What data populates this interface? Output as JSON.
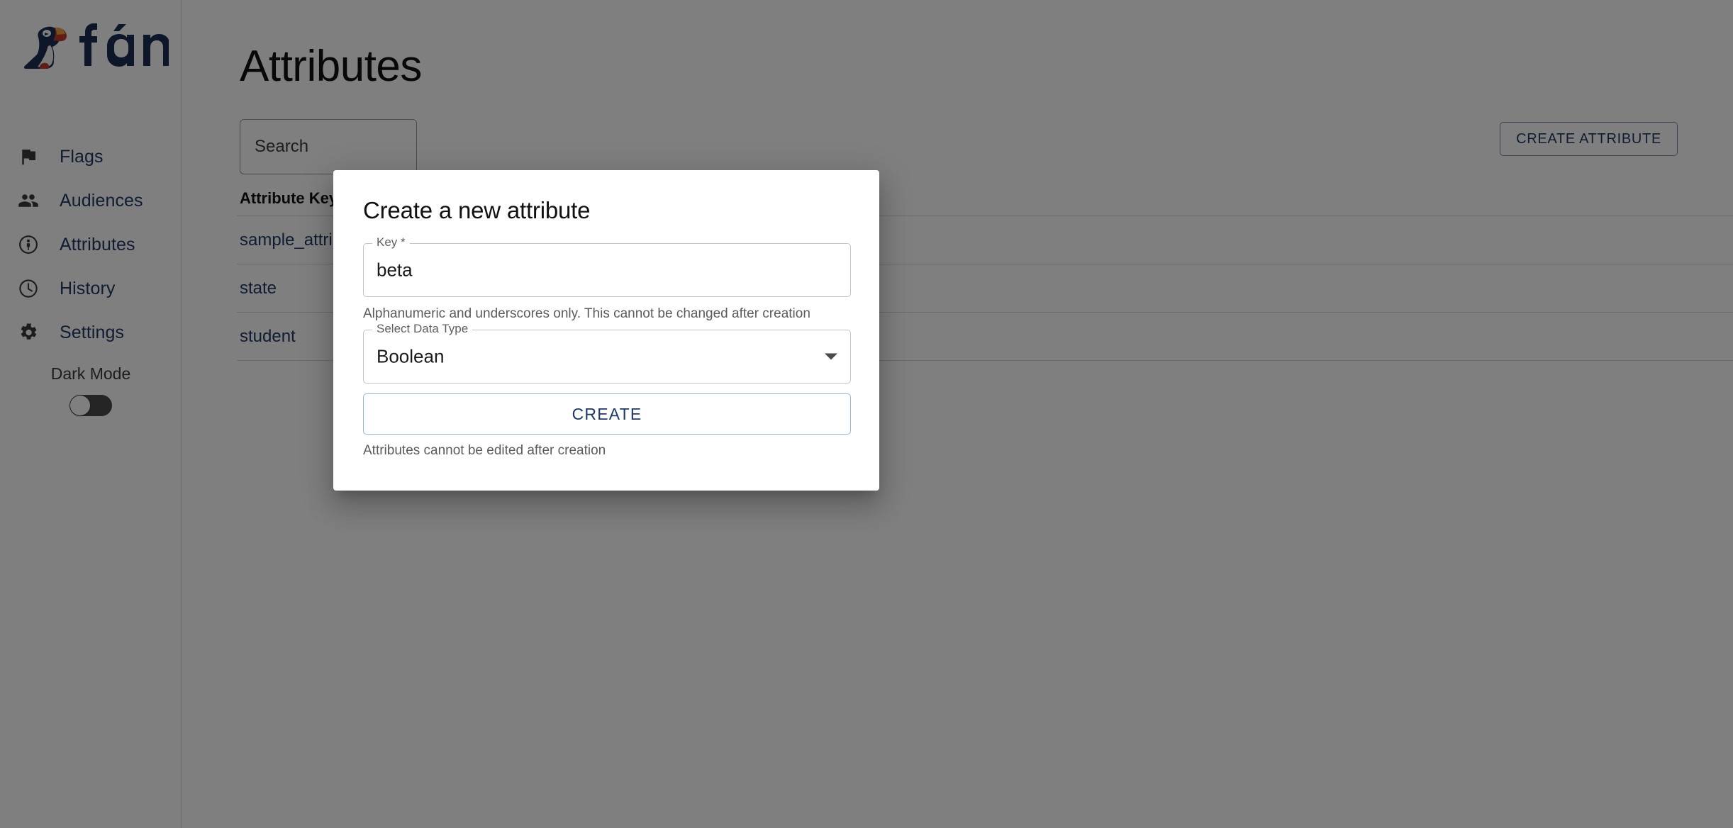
{
  "app": {
    "brand_name": "fána",
    "logo_icon": "puffin-logo",
    "colors": {
      "brand_navy": "#1f3864",
      "brand_red": "#b23a34",
      "brand_orange": "#e8a33d",
      "link_blue": "#1f3864",
      "scrim": "rgba(0,0,0,0.5)"
    }
  },
  "sidebar": {
    "items": [
      {
        "label": "Flags",
        "icon": "flag-icon"
      },
      {
        "label": "Audiences",
        "icon": "people-group-icon"
      },
      {
        "label": "Attributes",
        "icon": "account-info-circle-icon"
      },
      {
        "label": "History",
        "icon": "clock-icon"
      },
      {
        "label": "Settings",
        "icon": "gear-icon"
      }
    ],
    "dark_mode": {
      "label": "Dark Mode",
      "enabled": false
    }
  },
  "main": {
    "title": "Attributes",
    "search": {
      "placeholder": "Search",
      "value": ""
    },
    "create_attribute_button": "CREATE ATTRIBUTE",
    "table": {
      "columns": [
        "Attribute Key"
      ],
      "rows": [
        {
          "attribute_key": "sample_attribute"
        },
        {
          "attribute_key": "state"
        },
        {
          "attribute_key": "student"
        }
      ]
    }
  },
  "dialog": {
    "title": "Create a new attribute",
    "key_field": {
      "label": "Key *",
      "value": "beta",
      "helper_text": "Alphanumeric and underscores only. This cannot be changed after creation"
    },
    "data_type_field": {
      "label": "Select Data Type",
      "value": "Boolean",
      "caret_icon": "chevron-down-icon"
    },
    "submit_button": "CREATE",
    "footer_note": "Attributes cannot be edited after creation"
  }
}
